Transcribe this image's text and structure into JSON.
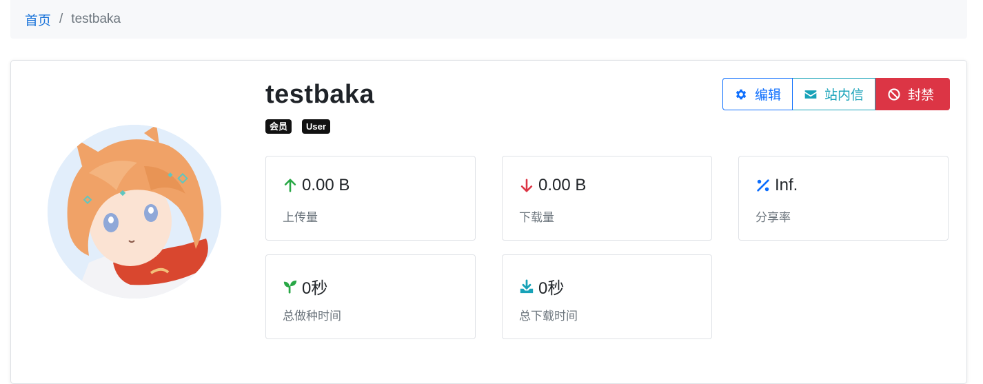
{
  "breadcrumb": {
    "home": "首页",
    "separator": "/",
    "current": "testbaka"
  },
  "profile": {
    "username": "testbaka",
    "badges": [
      "会员",
      "User"
    ]
  },
  "actions": {
    "edit": "编辑",
    "message": "站内信",
    "ban": "封禁"
  },
  "stats": {
    "upload": {
      "value": "0.00 B",
      "label": "上传量",
      "icon": "arrow-up-icon"
    },
    "download": {
      "value": "0.00 B",
      "label": "下载量",
      "icon": "arrow-down-icon"
    },
    "ratio": {
      "value": "Inf.",
      "label": "分享率",
      "icon": "percent-icon"
    },
    "seed_time": {
      "value": "0秒",
      "label": "总做种时间",
      "icon": "seedling-icon"
    },
    "leech_time": {
      "value": "0秒",
      "label": "总下载时间",
      "icon": "download-tray-icon"
    }
  },
  "colors": {
    "primary": "#0d6efd",
    "info": "#17a2b8",
    "danger": "#dc3545",
    "success": "#28a745"
  }
}
